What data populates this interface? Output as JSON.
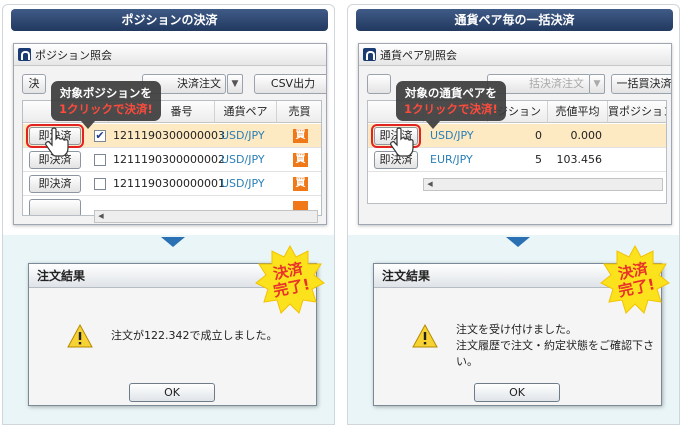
{
  "left_panel": {
    "banner": "ポジションの決済",
    "window_title": "ポジション照会",
    "toolbar": {
      "btn1": "決",
      "btn2": "決済注文",
      "csv": "CSV出力"
    },
    "columns": [
      "番号",
      "通貨ペア",
      "売買"
    ],
    "rows": [
      {
        "button": "即決済",
        "checked": true,
        "id": "1211190300000003",
        "pair": "USD/JPY",
        "side": "買"
      },
      {
        "button": "即決済",
        "checked": false,
        "id": "1211190300000002",
        "pair": "USD/JPY",
        "side": "買"
      },
      {
        "button": "即決済",
        "checked": false,
        "id": "1211190300000001",
        "pair": "USD/JPY",
        "side": "買"
      }
    ],
    "callout": {
      "line1": "対象ポジションを",
      "line2": "1クリックで決済!"
    },
    "dialog": {
      "title": "注文結果",
      "message_line1": "注文が122.342で成立しました。",
      "ok": "OK"
    },
    "stamp": {
      "line1": "決済",
      "line2": "完了!"
    }
  },
  "right_panel": {
    "banner": "通貨ペア毎の一括決済",
    "window_title": "通貨ペア別照会",
    "toolbar": {
      "btn_mid": "括決済注文",
      "btn_right": "一括買決済"
    },
    "columns": [
      "ジション",
      "売値平均",
      "買ポジション"
    ],
    "rows": [
      {
        "button": "即決済",
        "pair": "USD/JPY",
        "qty": "0",
        "avg": "0.000"
      },
      {
        "button": "即決済",
        "pair": "EUR/JPY",
        "qty": "5",
        "avg": "103.456"
      }
    ],
    "callout": {
      "line1": "対象の通貨ペアを",
      "line2": "1クリックで決済!"
    },
    "dialog": {
      "title": "注文結果",
      "message_line1": "注文を受け付けました。",
      "message_line2": "注文履歴で注文・約定状態をご確認下さい。",
      "ok": "OK"
    },
    "stamp": {
      "line1": "決済",
      "line2": "完了!"
    }
  },
  "colors": {
    "banner": "#2a3f66",
    "accent_red": "#e32222",
    "buy_badge": "#f07818",
    "pair_text": "#2a7fb6",
    "arrow": "#2a70b3"
  }
}
